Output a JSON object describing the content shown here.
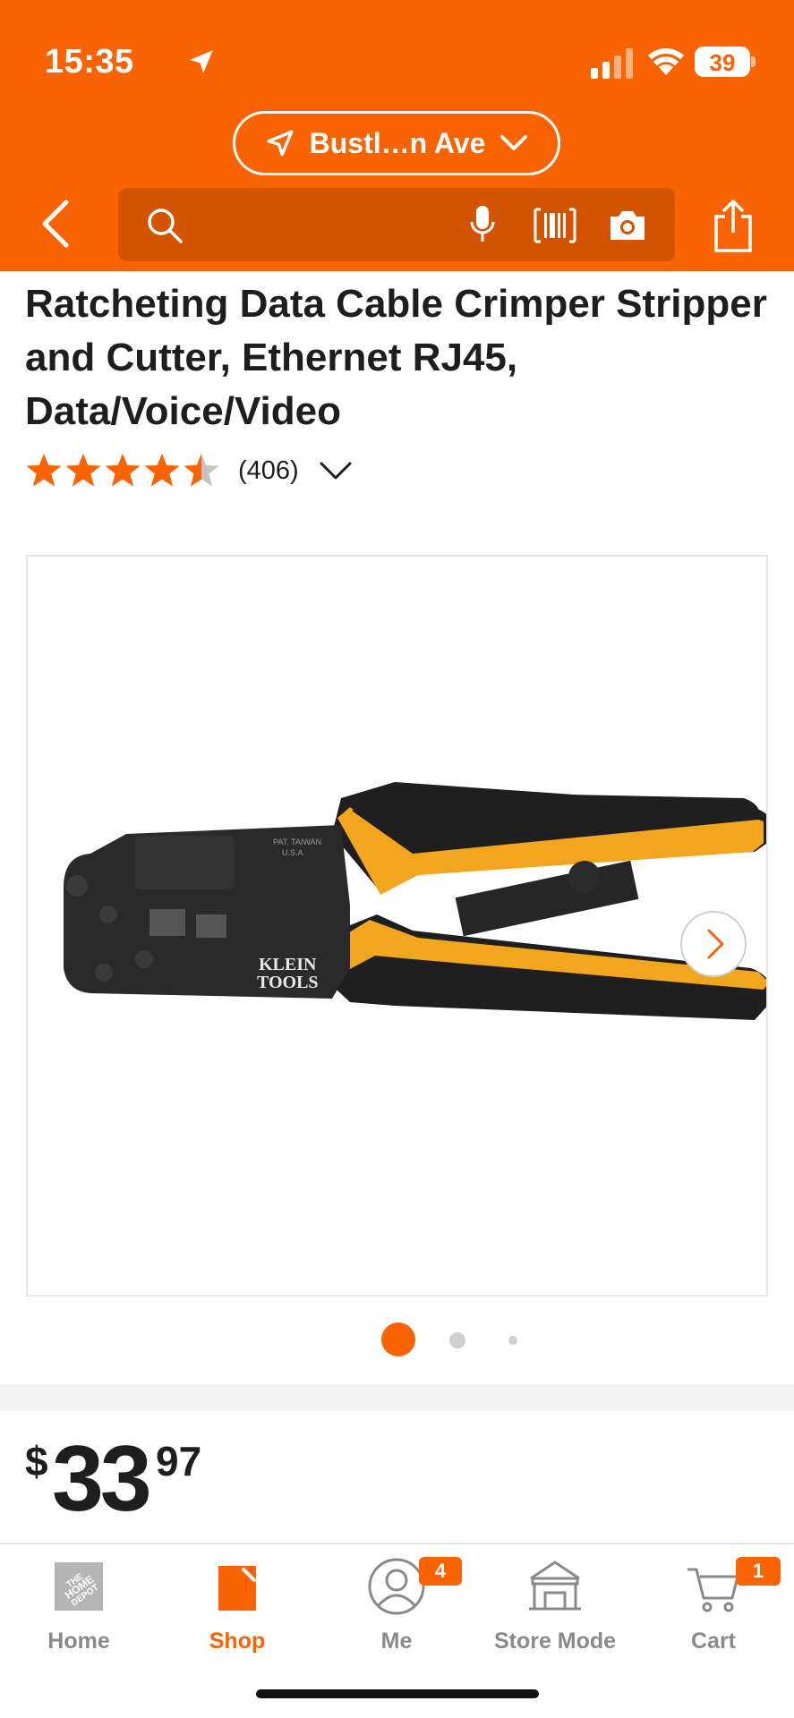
{
  "status_bar": {
    "time": "15:35",
    "battery": "39"
  },
  "header": {
    "location_label": "Bustl…n Ave",
    "search_placeholder": "",
    "icons": [
      "back-arrow-icon",
      "search-icon",
      "microphone-icon",
      "barcode-icon",
      "camera-icon",
      "share-icon"
    ],
    "brand_color": "#f96302"
  },
  "product": {
    "title": "Ratcheting Data Cable Crimper Stripper and Cutter, Ethernet RJ45, Data/Voice/Video",
    "rating": 4.5,
    "review_count": "(406)",
    "image_count": 3,
    "active_image_index": 0,
    "price": {
      "dollar_sign": "$",
      "whole": "33",
      "cents": "97"
    }
  },
  "tab_bar": {
    "tabs": [
      {
        "label": "Home",
        "icon": "home-depot-logo-icon",
        "active": false
      },
      {
        "label": "Shop",
        "icon": "shop-bag-icon",
        "active": true
      },
      {
        "label": "Me",
        "icon": "user-icon",
        "active": false,
        "badge": "4"
      },
      {
        "label": "Store Mode",
        "icon": "store-icon",
        "active": false
      },
      {
        "label": "Cart",
        "icon": "cart-icon",
        "active": false,
        "badge": "1"
      }
    ]
  }
}
